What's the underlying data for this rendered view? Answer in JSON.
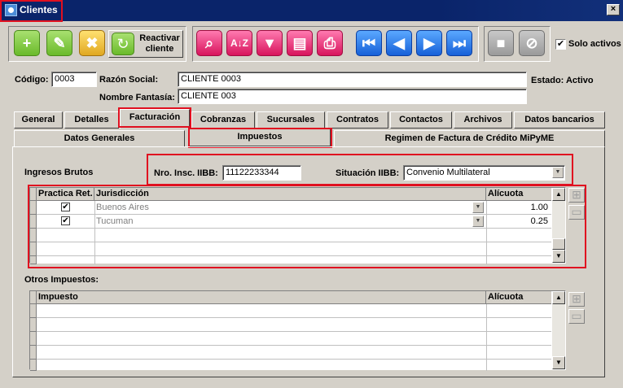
{
  "window": {
    "title": "Clientes",
    "close_glyph": "×"
  },
  "toolbar": {
    "reactivar_line1": "Reactivar",
    "reactivar_line2": "cliente",
    "solo_activos_label": "Solo activos",
    "solo_activos_checked": true,
    "check_glyph": "✔",
    "icons": [
      "plus-icon",
      "pencil-icon",
      "delete-icon",
      "reactivate-icon",
      "search-icon",
      "sort-az-icon",
      "filter-icon",
      "report-icon",
      "print-icon",
      "first-record-icon",
      "prev-record-icon",
      "next-record-icon",
      "last-record-icon",
      "disabled-save-icon",
      "disabled-cancel-icon"
    ]
  },
  "header": {
    "codigo_label": "Código:",
    "codigo_value": "0003",
    "razon_label": "Razón Social:",
    "razon_value": "CLIENTE 0003",
    "estado_text": "Estado: Activo",
    "fantasia_label": "Nombre Fantasía:",
    "fantasia_value": "CLIENTE 003"
  },
  "tabs": [
    "General",
    "Detalles",
    "Facturación",
    "Cobranzas",
    "Sucursales",
    "Contratos",
    "Contactos",
    "Archivos",
    "Datos bancarios"
  ],
  "active_tab": "Facturación",
  "subtabs": [
    "Datos Generales",
    "Impuestos",
    "Regimen de Factura de Crédito MiPyME"
  ],
  "active_subtab": "Impuestos",
  "iibb": {
    "section_label": "Ingresos Brutos",
    "nro_label": "Nro. Insc. IIBB:",
    "nro_value": "11122233344",
    "situacion_label": "Situación IIBB:",
    "situacion_value": "Convenio Multilateral"
  },
  "jurisdicciones": {
    "columns": [
      "Practica Ret.",
      "Jurisdicción",
      "Alícuota"
    ],
    "rows": [
      {
        "practica": true,
        "jurisdiccion": "Buenos Aires",
        "alicuota": "1.00"
      },
      {
        "practica": true,
        "jurisdiccion": "Tucuman",
        "alicuota": "0.25"
      }
    ]
  },
  "otros": {
    "section_label": "Otros Impuestos:",
    "columns": [
      "Impuesto",
      "Alícuota"
    ]
  },
  "colors": {
    "highlight": "#e01020",
    "titlebar": "#0a246a"
  }
}
